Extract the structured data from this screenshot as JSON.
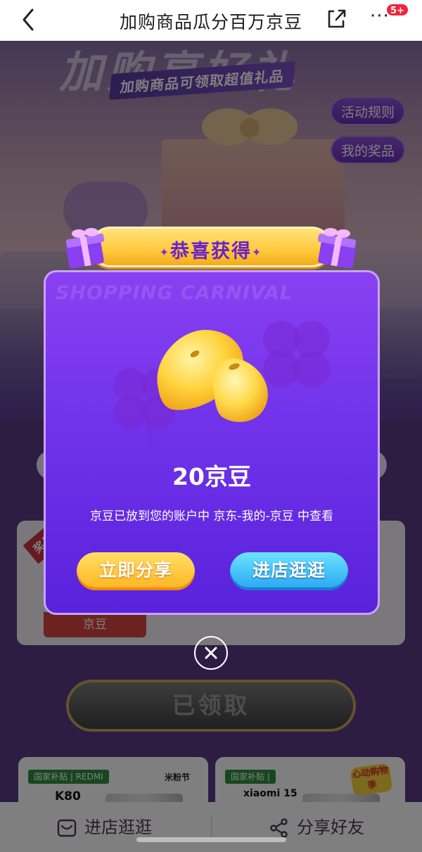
{
  "nav": {
    "title": "加购商品瓜分百万京豆",
    "badge": "5+"
  },
  "hero": {
    "big_title": "加购享好礼",
    "subtitle": "加购商品可领取超值礼品"
  },
  "side_buttons": {
    "rules": "活动规则",
    "prizes": "我的奖品"
  },
  "card": {
    "ribbon": "奖品",
    "label": "京豆"
  },
  "claimed_button": "已领取",
  "products": [
    {
      "tag": "国家补贴 | REDMI",
      "brand": "米粉节",
      "model": "K80"
    },
    {
      "tag": "国家补贴 | ",
      "model": "xiaomi 15",
      "promo": "心动购物季"
    }
  ],
  "bottom_bar": {
    "store": "进店逛逛",
    "share": "分享好友"
  },
  "modal": {
    "banner": "恭喜获得",
    "watermark": "SHOPPING CARNIVAL",
    "amount": "20京豆",
    "description": "京豆已放到您的账户中 京东-我的-京豆 中查看",
    "share_button": "立即分享",
    "store_button": "进店逛逛"
  },
  "colors": {
    "modal_top": "#8a40f2",
    "modal_bottom": "#5a22dc",
    "banner_gold": "#ffc83c",
    "share_button": "#ffb31f",
    "store_button": "#27a5f2",
    "badge": "#f0243b"
  }
}
